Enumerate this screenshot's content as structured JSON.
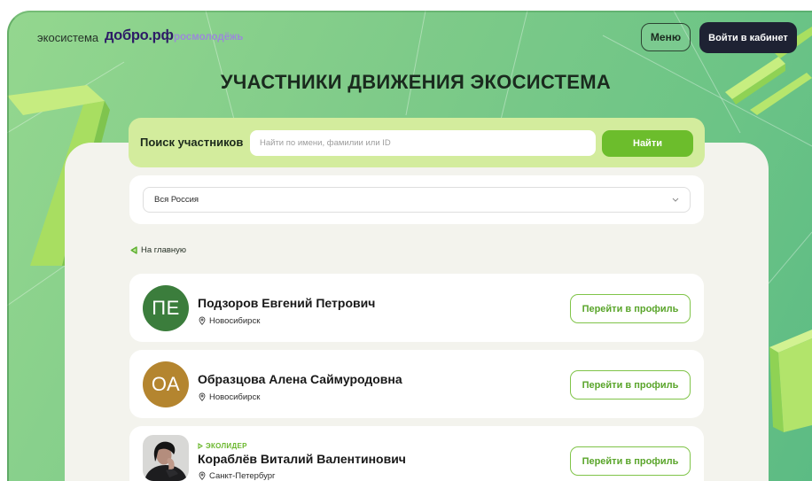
{
  "header": {
    "logo_ecosystem": "экосистема",
    "logo_dobro": "добро.рф",
    "logo_rosmolodezh": "росмолодёжь",
    "menu_label": "Меню",
    "login_label": "Войти в кабинет"
  },
  "page_title": "УЧАСТНИКИ ДВИЖЕНИЯ ЭКОСИСТЕМА",
  "search": {
    "label": "Поиск участников",
    "value": "",
    "placeholder": "Найти по имени, фамилии или ID",
    "button_label": "Найти"
  },
  "region_filter": {
    "selected": "Вся Россия",
    "icon": "chevron-down-icon"
  },
  "back_link": {
    "label": "На главную",
    "icon": "triangle-left-icon"
  },
  "participants": [
    {
      "initials": "ПЕ",
      "name": "Подзоров Евгений Петрович",
      "city": "Новосибирск",
      "avatar_color": "#3b7d3c",
      "profile_button": "Перейти в профиль"
    },
    {
      "initials": "ОА",
      "name": "Образцова Алена Саймуродовна",
      "city": "Новосибирск",
      "avatar_color": "#b4852f",
      "profile_button": "Перейти в профиль"
    },
    {
      "badge": "ЭКОЛИДЕР",
      "name": "Кораблёв Виталий Валентинович",
      "city": "Санкт-Петербург",
      "profile_button": "Перейти в профиль"
    }
  ],
  "icons": {
    "city": "location-pin-icon",
    "badge": "triangle-right-icon"
  },
  "colors": {
    "background_green": "#7fcb89",
    "accent_green": "#6cbd2c",
    "search_bar": "#d3ec9d",
    "panel": "#f3f3ed",
    "dark_button": "#1e2233",
    "title_text": "#1a2a1e",
    "logo_purple": "#2d1b66",
    "logo_lilac": "#9b8ad8"
  }
}
